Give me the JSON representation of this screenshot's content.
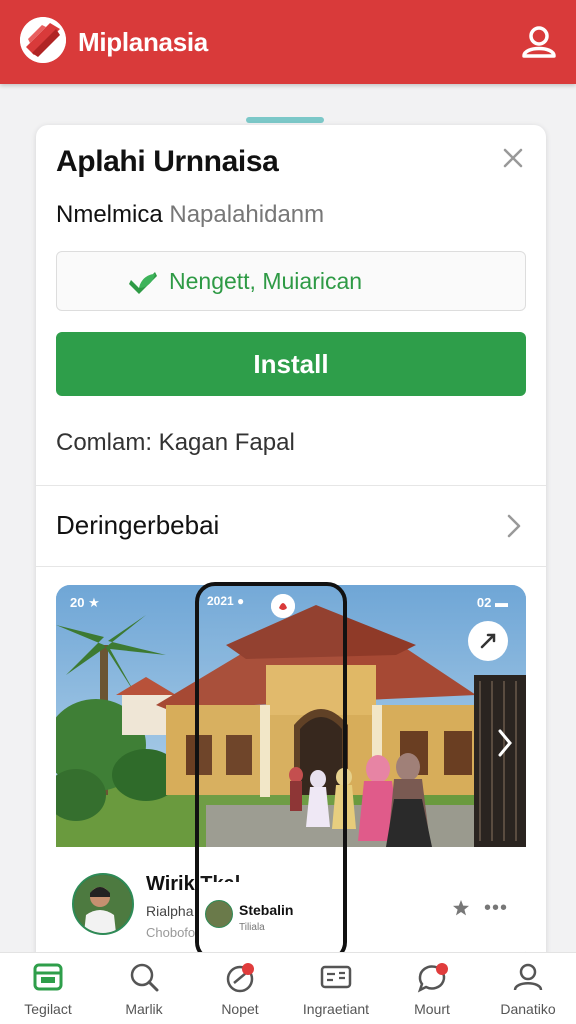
{
  "app": {
    "title": "Miplanasia"
  },
  "sheet": {
    "title": "Aplahi Urnnaisa",
    "subtitle_main": "Nmelmica",
    "subtitle_muted": "Napalahidanm",
    "verify_text": "Nengett, Muiarican",
    "install_label": "Install",
    "contains_text": "Comlam: Kagan Fapal",
    "details_label": "Deringerbebai"
  },
  "screenshot": {
    "status_left": "20 ★",
    "status_right": "02 ▬",
    "profile_name": "Wirik Tkal",
    "profile_line1": "Rialpha",
    "profile_line2": "Choboform",
    "more_label": "•••"
  },
  "phone": {
    "status": "2021 ●",
    "name": "Stebalin",
    "sub": "Tiliala"
  },
  "bottom_nav": [
    {
      "label": "Tegilact",
      "icon": "store-icon"
    },
    {
      "label": "Marlik",
      "icon": "search-icon"
    },
    {
      "label": "Nopet",
      "icon": "notes-icon"
    },
    {
      "label": "Ingraetiant",
      "icon": "cards-icon"
    },
    {
      "label": "Mourt",
      "icon": "chat-icon"
    },
    {
      "label": "Danatiko",
      "icon": "person-icon"
    }
  ],
  "colors": {
    "appbar": "#d93a3a",
    "install": "#2e9e4a",
    "verify": "#2e9a45",
    "accent_handle": "#7cc8c8",
    "nav_active": "#2e9e4a"
  }
}
